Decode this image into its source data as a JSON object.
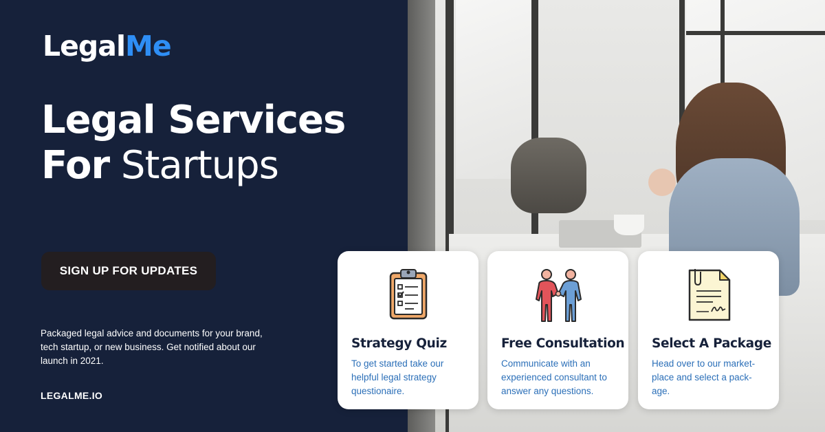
{
  "brand": {
    "logo_main": "Legal",
    "logo_accent": "Me"
  },
  "hero": {
    "headline_line1": "Legal Services",
    "headline_line2_bold": "For",
    "headline_line2_light": "Startups"
  },
  "cta": {
    "label": "SIGN UP FOR UPDATES"
  },
  "description": "Packaged legal advice and documents for your brand, tech startup, or new business. Get notified about our launch in 2021.",
  "website": "LEGALME.IO",
  "cards": [
    {
      "icon": "clipboard-checklist-icon",
      "title": "Strategy Quiz",
      "text": "To get started take our helpful legal strategy questionaire."
    },
    {
      "icon": "people-handshake-icon",
      "title": "Free Consultation",
      "text": "Communicate with an experienced consultant to answer any questions."
    },
    {
      "icon": "signed-document-icon",
      "title": "Select A Package",
      "text": "Head over to our market-place and select a pack-age."
    }
  ],
  "colors": {
    "navy": "#16213a",
    "accent_blue": "#2e8ef5",
    "link_blue": "#2b6fb8",
    "button_dark": "#231e20"
  }
}
